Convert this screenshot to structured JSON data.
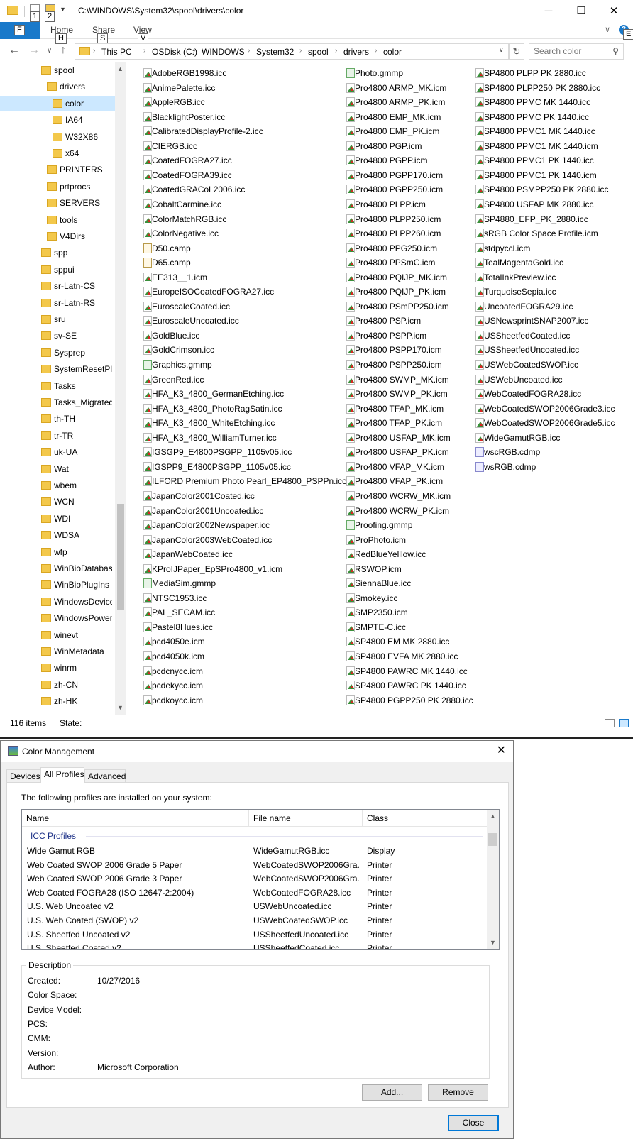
{
  "explorer": {
    "title": "C:\\WINDOWS\\System32\\spool\\drivers\\color",
    "qat_keytips": [
      "1",
      "2"
    ],
    "ribbon": {
      "file_keytip": "F",
      "tabs": [
        {
          "label": "Home",
          "keytip": "H"
        },
        {
          "label": "Share",
          "keytip": "S"
        },
        {
          "label": "View",
          "keytip": "V"
        }
      ],
      "help_keytip": "E"
    },
    "window_buttons": {
      "minimize": "─",
      "maximize": "☐",
      "close": "✕"
    },
    "breadcrumbs": [
      "This PC",
      "OSDisk (C:)",
      "WINDOWS",
      "System32",
      "spool",
      "drivers",
      "color"
    ],
    "search": {
      "placeholder": "Search color"
    },
    "tree": [
      {
        "label": "spool",
        "indent": 0
      },
      {
        "label": "drivers",
        "indent": 1
      },
      {
        "label": "color",
        "indent": 2,
        "selected": true
      },
      {
        "label": "IA64",
        "indent": 2
      },
      {
        "label": "W32X86",
        "indent": 2
      },
      {
        "label": "x64",
        "indent": 2
      },
      {
        "label": "PRINTERS",
        "indent": 1
      },
      {
        "label": "prtprocs",
        "indent": 1
      },
      {
        "label": "SERVERS",
        "indent": 1
      },
      {
        "label": "tools",
        "indent": 1
      },
      {
        "label": "V4Dirs",
        "indent": 1
      },
      {
        "label": "spp",
        "indent": 0
      },
      {
        "label": "sppui",
        "indent": 0
      },
      {
        "label": "sr-Latn-CS",
        "indent": 0
      },
      {
        "label": "sr-Latn-RS",
        "indent": 0
      },
      {
        "label": "sru",
        "indent": 0
      },
      {
        "label": "sv-SE",
        "indent": 0
      },
      {
        "label": "Sysprep",
        "indent": 0
      },
      {
        "label": "SystemResetPlat",
        "indent": 0
      },
      {
        "label": "Tasks",
        "indent": 0
      },
      {
        "label": "Tasks_Migrated",
        "indent": 0
      },
      {
        "label": "th-TH",
        "indent": 0
      },
      {
        "label": "tr-TR",
        "indent": 0
      },
      {
        "label": "uk-UA",
        "indent": 0
      },
      {
        "label": "Wat",
        "indent": 0
      },
      {
        "label": "wbem",
        "indent": 0
      },
      {
        "label": "WCN",
        "indent": 0
      },
      {
        "label": "WDI",
        "indent": 0
      },
      {
        "label": "WDSA",
        "indent": 0
      },
      {
        "label": "wfp",
        "indent": 0
      },
      {
        "label": "WinBioDatabase",
        "indent": 0
      },
      {
        "label": "WinBioPlugIns",
        "indent": 0
      },
      {
        "label": "WindowsDevice",
        "indent": 0
      },
      {
        "label": "WindowsPowerS",
        "indent": 0
      },
      {
        "label": "winevt",
        "indent": 0
      },
      {
        "label": "WinMetadata",
        "indent": 0
      },
      {
        "label": "winrm",
        "indent": 0
      },
      {
        "label": "zh-CN",
        "indent": 0
      },
      {
        "label": "zh-HK",
        "indent": 0
      }
    ],
    "file_columns": [
      [
        "AdobeRGB1998.icc",
        "AnimePalette.icc",
        "AppleRGB.icc",
        "BlacklightPoster.icc",
        "CalibratedDisplayProfile-2.icc",
        "CIERGB.icc",
        "CoatedFOGRA27.icc",
        "CoatedFOGRA39.icc",
        "CoatedGRACoL2006.icc",
        "CobaltCarmine.icc",
        "ColorMatchRGB.icc",
        "ColorNegative.icc",
        "D50.camp",
        "D65.camp",
        "EE313__1.icm",
        "EuropeISOCoatedFOGRA27.icc",
        "EuroscaleCoated.icc",
        "EuroscaleUncoated.icc",
        "GoldBlue.icc",
        "GoldCrimson.icc",
        "Graphics.gmmp",
        "GreenRed.icc",
        "HFA_K3_4800_GermanEtching.icc",
        "HFA_K3_4800_PhotoRagSatin.icc",
        "HFA_K3_4800_WhiteEtching.icc",
        "HFA_K3_4800_WilliamTurner.icc",
        "IGSGP9_E4800PSGPP_1105v05.icc",
        "IGSPP9_E4800PSGPP_1105v05.icc",
        "ILFORD Premium Photo Pearl_EP4800_PSPPn.icc",
        "JapanColor2001Coated.icc",
        "JapanColor2001Uncoated.icc",
        "JapanColor2002Newspaper.icc",
        "JapanColor2003WebCoated.icc",
        "JapanWebCoated.icc",
        "KProIJPaper_EpSPro4800_v1.icm",
        "MediaSim.gmmp",
        "NTSC1953.icc",
        "PAL_SECAM.icc",
        "Pastel8Hues.icc",
        "pcd4050e.icm",
        "pcd4050k.icm",
        "pcdcnycc.icm",
        "pcdekycc.icm",
        "pcdkoycc.icm"
      ],
      [
        "Photo.gmmp",
        "Pro4800 ARMP_MK.icm",
        "Pro4800 ARMP_PK.icm",
        "Pro4800 EMP_MK.icm",
        "Pro4800 EMP_PK.icm",
        "Pro4800 PGP.icm",
        "Pro4800 PGPP.icm",
        "Pro4800 PGPP170.icm",
        "Pro4800 PGPP250.icm",
        "Pro4800 PLPP.icm",
        "Pro4800 PLPP250.icm",
        "Pro4800 PLPP260.icm",
        "Pro4800 PPG250.icm",
        "Pro4800 PPSmC.icm",
        "Pro4800 PQIJP_MK.icm",
        "Pro4800 PQIJP_PK.icm",
        "Pro4800 PSmPP250.icm",
        "Pro4800 PSP.icm",
        "Pro4800 PSPP.icm",
        "Pro4800 PSPP170.icm",
        "Pro4800 PSPP250.icm",
        "Pro4800 SWMP_MK.icm",
        "Pro4800 SWMP_PK.icm",
        "Pro4800 TFAP_MK.icm",
        "Pro4800 TFAP_PK.icm",
        "Pro4800 USFAP_MK.icm",
        "Pro4800 USFAP_PK.icm",
        "Pro4800 VFAP_MK.icm",
        "Pro4800 VFAP_PK.icm",
        "Pro4800 WCRW_MK.icm",
        "Pro4800 WCRW_PK.icm",
        "Proofing.gmmp",
        "ProPhoto.icm",
        "RedBlueYelllow.icc",
        "RSWOP.icm",
        "SiennaBlue.icc",
        "Smokey.icc",
        "SMP2350.icm",
        "SMPTE-C.icc",
        "SP4800 EM MK 2880.icc",
        "SP4800 EVFA MK 2880.icc",
        "SP4800 PAWRC MK 1440.icc",
        "SP4800 PAWRC PK 1440.icc",
        "SP4800 PGPP250 PK 2880.icc"
      ],
      [
        "SP4800 PLPP PK 2880.icc",
        "SP4800 PLPP250 PK 2880.icc",
        "SP4800 PPMC MK 1440.icc",
        "SP4800 PPMC PK 1440.icc",
        "SP4800 PPMC1 MK 1440.icc",
        "SP4800 PPMC1 MK 1440.icm",
        "SP4800 PPMC1 PK 1440.icc",
        "SP4800 PPMC1 PK 1440.icm",
        "SP4800 PSMPP250 PK 2880.icc",
        "SP4800 USFAP MK 2880.icc",
        "SP4880_EFP_PK_2880.icc",
        "sRGB Color Space Profile.icm",
        "stdpyccl.icm",
        "TealMagentaGold.icc",
        "TotalInkPreview.icc",
        "TurquoiseSepia.icc",
        "UncoatedFOGRA29.icc",
        "USNewsprintSNAP2007.icc",
        "USSheetfedCoated.icc",
        "USSheetfedUncoated.icc",
        "USWebCoatedSWOP.icc",
        "USWebUncoated.icc",
        "WebCoatedFOGRA28.icc",
        "WebCoatedSWOP2006Grade3.icc",
        "WebCoatedSWOP2006Grade5.icc",
        "WideGamutRGB.icc",
        "wscRGB.cdmp",
        "wsRGB.cdmp"
      ]
    ],
    "status": {
      "item_count": "116 items",
      "state_label": "State:"
    }
  },
  "dialog": {
    "title": "Color Management",
    "close_glyph": "✕",
    "tabs": [
      "Devices",
      "All Profiles",
      "Advanced"
    ],
    "active_tab": "All Profiles",
    "intro": "The following profiles are installed on your system:",
    "columns": [
      "Name",
      "File name",
      "Class"
    ],
    "group_label": "ICC Profiles",
    "rows": [
      {
        "name": "Wide Gamut RGB",
        "file": "WideGamutRGB.icc",
        "class": "Display"
      },
      {
        "name": "Web Coated SWOP 2006 Grade 5 Paper",
        "file": "WebCoatedSWOP2006Gra...",
        "class": "Printer"
      },
      {
        "name": "Web Coated SWOP 2006 Grade 3 Paper",
        "file": "WebCoatedSWOP2006Gra...",
        "class": "Printer"
      },
      {
        "name": "Web Coated FOGRA28 (ISO 12647-2:2004)",
        "file": "WebCoatedFOGRA28.icc",
        "class": "Printer"
      },
      {
        "name": "U.S. Web Uncoated v2",
        "file": "USWebUncoated.icc",
        "class": "Printer"
      },
      {
        "name": "U.S. Web Coated (SWOP) v2",
        "file": "USWebCoatedSWOP.icc",
        "class": "Printer"
      },
      {
        "name": "U.S. Sheetfed Uncoated v2",
        "file": "USSheetfedUncoated.icc",
        "class": "Printer"
      },
      {
        "name": "U.S. Sheetfed Coated v2",
        "file": "USSheetfedCoated.icc",
        "class": "Printer"
      }
    ],
    "description": {
      "legend": "Description",
      "fields": [
        {
          "label": "Created:",
          "value": "10/27/2016"
        },
        {
          "label": "Color Space:",
          "value": ""
        },
        {
          "label": "Device Model:",
          "value": ""
        },
        {
          "label": "PCS:",
          "value": ""
        },
        {
          "label": "CMM:",
          "value": ""
        },
        {
          "label": "Version:",
          "value": ""
        },
        {
          "label": "Author:",
          "value": "Microsoft Corporation"
        }
      ]
    },
    "buttons": {
      "add": "Add...",
      "remove": "Remove",
      "close": "Close"
    }
  }
}
